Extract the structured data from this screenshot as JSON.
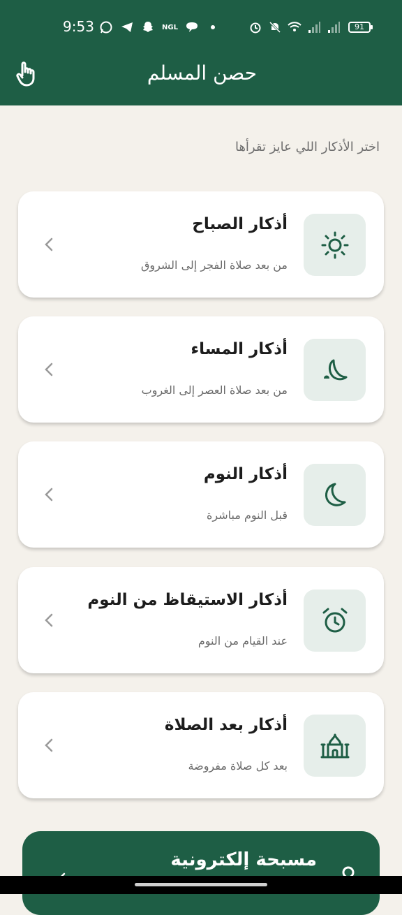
{
  "status_bar": {
    "time": "9:53",
    "ngl_label": "NGL",
    "battery": "91"
  },
  "header": {
    "title": "حصن المسلم",
    "menu_icon": "hand-pointer-icon"
  },
  "subtitle": "اختر الأذكار اللي عايز تقرأها",
  "cards": [
    {
      "title": "أذكار الصباح",
      "desc": "من بعد صلاة الفجر إلى الشروق",
      "icon": "sun-icon"
    },
    {
      "title": "أذكار المساء",
      "desc": "من بعد صلاة العصر إلى الغروب",
      "icon": "sunset-moon-icon"
    },
    {
      "title": "أذكار النوم",
      "desc": "قبل النوم مباشرة",
      "icon": "moon-icon"
    },
    {
      "title": "أذكار الاستيقاظ من النوم",
      "desc": "عند القيام من النوم",
      "icon": "alarm-clock-icon"
    },
    {
      "title": "أذكار بعد الصلاة",
      "desc": "بعد كل صلاة مفروضة",
      "icon": "mosque-icon"
    }
  ],
  "bottom_card": {
    "title": "مسبحة إلكترونية"
  },
  "colors": {
    "primary": "#1e5e45",
    "background": "#f4f1eb",
    "card": "#ffffff",
    "icon_bg": "#e6eeea"
  }
}
